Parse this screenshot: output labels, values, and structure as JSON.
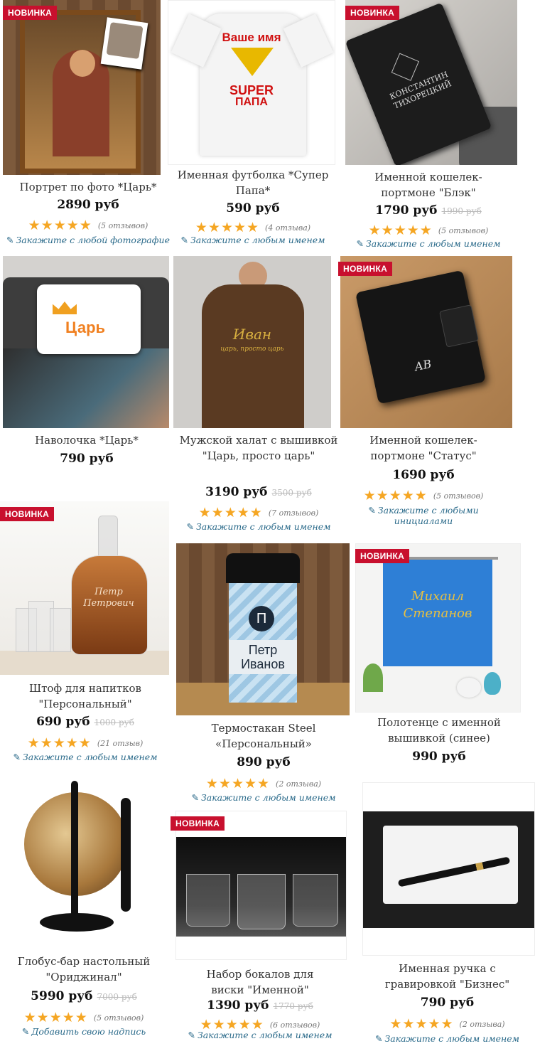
{
  "badge_label": "НОВИНКА",
  "products": [
    {
      "title": "Портрет по фото *Царь*",
      "price": "2890 руб",
      "old_price": "",
      "reviews": "(5 отзывов)",
      "personal": "Закажите с любой фотографие",
      "new": true,
      "img": {
        "colors": [
          "#6b4a30",
          "#a97b3f"
        ],
        "art": "portrait"
      }
    },
    {
      "title": "Именная футболка *Супер Папа*",
      "price": "590 руб",
      "old_price": "",
      "reviews": "(4 отзыва)",
      "personal": "Закажите с любым именем",
      "new": false,
      "img": {
        "colors": [
          "#f2f2f2",
          "#fff"
        ],
        "art": "tshirt",
        "name_text": "Ваше имя",
        "super_text": "SUPER",
        "papa_text": "ПАПА"
      }
    },
    {
      "title": "Именной кошелек-портмоне \"Блэк\"",
      "price": "1790 руб",
      "old_price": "1990 руб",
      "reviews": "(5 отзывов)",
      "personal": "Закажите с любым именем",
      "new": true,
      "img": {
        "colors": [
          "#c9c6c1",
          "#1c1c1c"
        ],
        "art": "wallet",
        "engrave": "КОНСТАНТИН ТИХОРЕЦКИЙ"
      }
    },
    {
      "title": "Наволочка *Царь*",
      "price": "790 руб",
      "old_price": "",
      "reviews": "",
      "personal": "",
      "new": false,
      "img": {
        "colors": [
          "#555",
          "#fff"
        ],
        "art": "pillow",
        "word": "Царь"
      }
    },
    {
      "title": "Мужской халат с вышивкой \"Царь, просто царь\"",
      "price": "3190 руб",
      "old_price": "3500 руб",
      "reviews": "(7 отзывов)",
      "personal": "Закажите с любым именем",
      "new": false,
      "img": {
        "colors": [
          "#c7c4bf",
          "#5a3a22"
        ],
        "art": "robe",
        "name": "Иван",
        "sub": "царь, просто царь"
      }
    },
    {
      "title": "Именной кошелек-портмоне \"Статус\"",
      "price": "1690 руб",
      "old_price": "",
      "reviews": "(5 отзывов)",
      "personal": "Закажите с любыми инициалами",
      "new": true,
      "img": {
        "colors": [
          "#b78a5a",
          "#111"
        ],
        "art": "wallet2",
        "initials": "АВ"
      }
    },
    {
      "title": "Штоф для напитков \"Персональный\"",
      "price": "690 руб",
      "old_price": "1000 руб",
      "reviews": "(21 отзыв)",
      "personal": "Закажите с любым именем",
      "new": true,
      "img": {
        "colors": [
          "#f3f1ee",
          "#b5651d"
        ],
        "art": "decanter",
        "engrave": "Петр Петрович"
      }
    },
    {
      "title": "Термостакан Steel «Персональный»",
      "price": "890 руб",
      "old_price": "",
      "reviews": "(2 отзыва)",
      "personal": "Закажите с любым именем",
      "new": false,
      "img": {
        "colors": [
          "#7a5a3e",
          "#9ec7e3"
        ],
        "art": "thermos",
        "letter": "П",
        "name": "Петр Иванов"
      }
    },
    {
      "title": "Полотенце с именной вышивкой (синее)",
      "price": "990 руб",
      "old_price": "",
      "reviews": "",
      "personal": "",
      "new": true,
      "img": {
        "colors": [
          "#e9e9e9",
          "#2e7fd6"
        ],
        "art": "towel",
        "name": "Михаил Степанов"
      }
    },
    {
      "title": "Глобус-бар настольный \"Ориджинал\"",
      "price": "5990 руб",
      "old_price": "7000 руб",
      "reviews": "(5 отзывов)",
      "personal": "Добавить свою надпись",
      "new": false,
      "img": {
        "colors": [
          "#fff",
          "#7a5a30"
        ],
        "art": "globe"
      }
    },
    {
      "title": "Набор бокалов для виски \"Именной\"",
      "price": "1390 руб",
      "old_price": "1770 руб",
      "reviews": "(6 отзывов)",
      "personal": "Закажите с любым именем",
      "new": true,
      "img": {
        "colors": [
          "#1a1a1a",
          "#777"
        ],
        "art": "glasses"
      }
    },
    {
      "title": "Именная ручка с гравировкой \"Бизнес\"",
      "price": "790 руб",
      "old_price": "",
      "reviews": "(2 отзыва)",
      "personal": "Закажите с любым именем",
      "new": false,
      "img": {
        "colors": [
          "#1e1e1e",
          "#fff"
        ],
        "art": "pen"
      }
    }
  ],
  "stars_glyph": "★★★★★",
  "pencil_glyph": "✎"
}
